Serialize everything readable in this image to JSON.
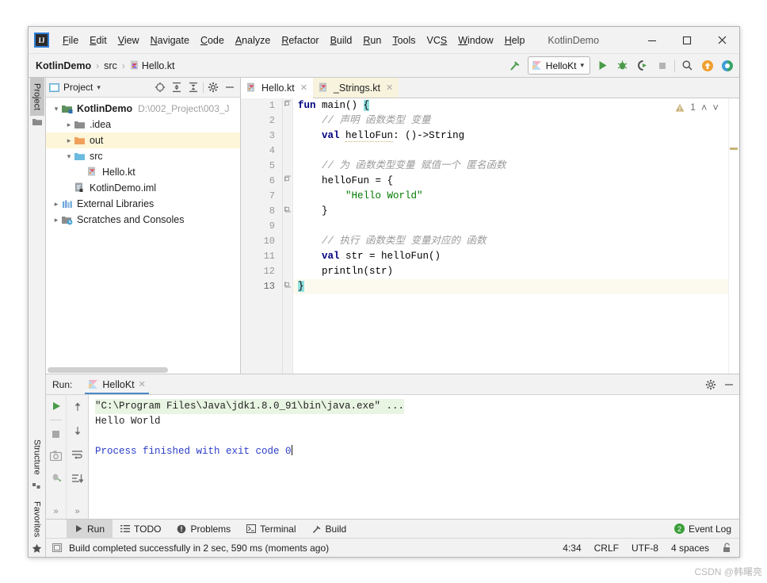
{
  "window": {
    "title": "KotlinDemo",
    "minimize": "—",
    "maximize": "☐",
    "close": "✕",
    "logo_text": "IJ"
  },
  "menubar": {
    "items": [
      {
        "label": "File",
        "mnemonic": "F"
      },
      {
        "label": "Edit",
        "mnemonic": "E"
      },
      {
        "label": "View",
        "mnemonic": "V"
      },
      {
        "label": "Navigate",
        "mnemonic": "N"
      },
      {
        "label": "Code",
        "mnemonic": "C"
      },
      {
        "label": "Analyze",
        "mnemonic": "A"
      },
      {
        "label": "Refactor",
        "mnemonic": "R"
      },
      {
        "label": "Build",
        "mnemonic": "B"
      },
      {
        "label": "Run",
        "mnemonic": "R"
      },
      {
        "label": "Tools",
        "mnemonic": "T"
      },
      {
        "label": "VCS",
        "mnemonic": "S"
      },
      {
        "label": "Window",
        "mnemonic": "W"
      },
      {
        "label": "Help",
        "mnemonic": "H"
      }
    ]
  },
  "navbar": {
    "crumbs": [
      "KotlinDemo",
      "src",
      "Hello.kt"
    ],
    "separator": "›",
    "run_config": "HelloKt",
    "dropdown_arrow": "▾"
  },
  "vertical_tabs": {
    "left": [
      "Project",
      "Structure",
      "Favorites"
    ]
  },
  "project_panel": {
    "title": "Project",
    "dropdown_arrow": "▾",
    "tree": [
      {
        "label": "KotlinDemo",
        "path": "D:\\002_Project\\003_J",
        "depth": 0,
        "arrow": "ⱟ",
        "bold": true,
        "icon": "module-icon",
        "highlight": false
      },
      {
        "label": ".idea",
        "path": "",
        "depth": 1,
        "arrow": "›",
        "bold": false,
        "icon": "folder-gray-icon",
        "highlight": false
      },
      {
        "label": "out",
        "path": "",
        "depth": 1,
        "arrow": "›",
        "bold": false,
        "icon": "folder-orange-icon",
        "highlight": true
      },
      {
        "label": "src",
        "path": "",
        "depth": 1,
        "arrow": "ⱟ",
        "bold": false,
        "icon": "folder-blue-icon",
        "highlight": false
      },
      {
        "label": "Hello.kt",
        "path": "",
        "depth": 2,
        "arrow": "",
        "bold": false,
        "icon": "kotlin-file-icon",
        "highlight": false
      },
      {
        "label": "KotlinDemo.iml",
        "path": "",
        "depth": 1,
        "arrow": "",
        "bold": false,
        "icon": "iml-file-icon",
        "highlight": false
      },
      {
        "label": "External Libraries",
        "path": "",
        "depth": 0,
        "arrow": "›",
        "bold": false,
        "icon": "libraries-icon",
        "highlight": false
      },
      {
        "label": "Scratches and Consoles",
        "path": "",
        "depth": 0,
        "arrow": "›",
        "bold": false,
        "icon": "scratches-icon",
        "highlight": false
      }
    ]
  },
  "editor": {
    "tabs": [
      {
        "label": "Hello.kt",
        "active": true,
        "readonly": false,
        "close": "✕"
      },
      {
        "label": "_Strings.kt",
        "active": false,
        "readonly": true,
        "close": "✕"
      }
    ],
    "inspection": {
      "warning_count": "1",
      "warning_glyph": "⚠",
      "up": "˄",
      "down": "˅"
    },
    "line_count": 13,
    "current_line": 13,
    "lines": [
      {
        "n": 1,
        "text": "fun main() {"
      },
      {
        "n": 2,
        "text": "    // 声明 函数类型 变量"
      },
      {
        "n": 3,
        "text": "    val helloFun: ()->String"
      },
      {
        "n": 4,
        "text": ""
      },
      {
        "n": 5,
        "text": "    // 为 函数类型变量 赋值一个 匿名函数"
      },
      {
        "n": 6,
        "text": "    helloFun = {"
      },
      {
        "n": 7,
        "text": "        \"Hello World\""
      },
      {
        "n": 8,
        "text": "    }"
      },
      {
        "n": 9,
        "text": ""
      },
      {
        "n": 10,
        "text": "    // 执行 函数类型 变量对应的 函数"
      },
      {
        "n": 11,
        "text": "    val str = helloFun()"
      },
      {
        "n": 12,
        "text": "    println(str)"
      },
      {
        "n": 13,
        "text": "}"
      }
    ]
  },
  "run_window": {
    "label": "Run:",
    "tab": "HelloKt",
    "tab_close": "✕",
    "console": [
      {
        "text": "\"C:\\Program Files\\Java\\jdk1.8.0_91\\bin\\java.exe\" ...",
        "style": "cmd"
      },
      {
        "text": "Hello World",
        "style": "out"
      },
      {
        "text": "",
        "style": "out"
      },
      {
        "text": "Process finished with exit code 0",
        "style": "fin"
      }
    ]
  },
  "bottom_tabs": {
    "items": [
      {
        "label": "Run",
        "icon": "play-icon",
        "active": true
      },
      {
        "label": "TODO",
        "icon": "todo-icon",
        "active": false
      },
      {
        "label": "Problems",
        "icon": "problems-icon",
        "active": false
      },
      {
        "label": "Terminal",
        "icon": "terminal-icon",
        "active": false
      },
      {
        "label": "Build",
        "icon": "build-icon",
        "active": false
      }
    ],
    "event_log": {
      "label": "Event Log",
      "count": "2"
    }
  },
  "statusbar": {
    "message": "Build completed successfully in 2 sec, 590 ms (moments ago)",
    "caret_position": "4:34",
    "line_separator": "CRLF",
    "encoding": "UTF-8",
    "indent": "4 spaces",
    "lock_icon": "🔓"
  },
  "watermark": "CSDN @韩曙亮",
  "colors": {
    "accent_blue": "#4a88c7",
    "green": "#3a9e3a",
    "orange": "#f0a030",
    "keyword": "#000080",
    "string": "#027a00",
    "comment": "#9a9a9a",
    "warning": "#c9b27a"
  }
}
